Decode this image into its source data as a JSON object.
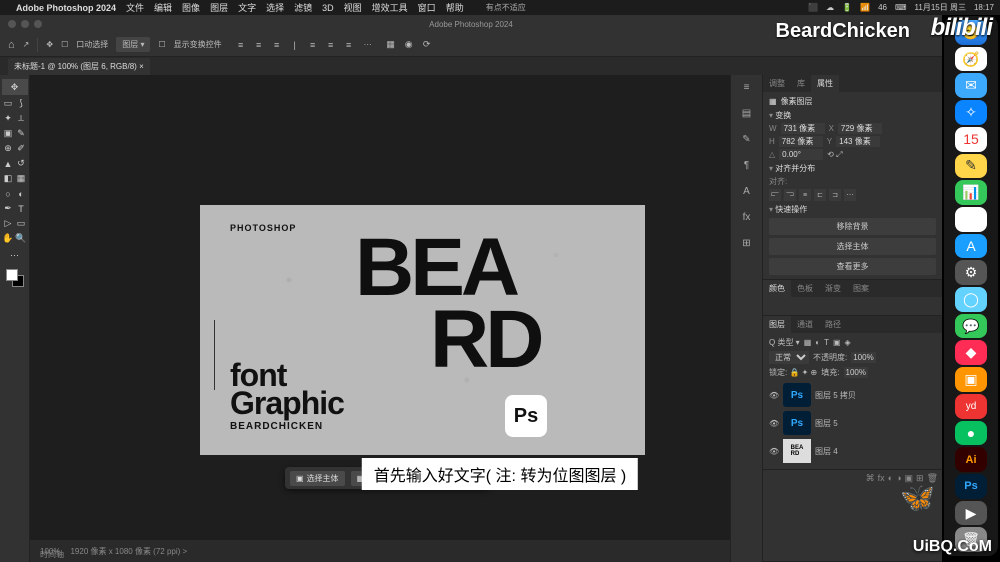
{
  "menubar": {
    "app": "Adobe Photoshop 2024",
    "items": [
      "文件",
      "编辑",
      "图像",
      "图层",
      "文字",
      "选择",
      "滤镜",
      "3D",
      "视图",
      "增效工具",
      "窗口",
      "帮助"
    ],
    "note": "有点不适应",
    "right": {
      "num1": "46",
      "label1": "周三",
      "date": "11月15日 周三",
      "time": "18:17"
    }
  },
  "window_title": "Adobe Photoshop 2024",
  "options": {
    "auto_select": "口动选择",
    "layer_dd": "图层 ▾",
    "show_transform": "显示变换控件",
    "three_dots": "···"
  },
  "tab": {
    "name": "未标题-1 @ 100% (图层 6, RGB/8)",
    "close": "×"
  },
  "status": {
    "zoom": "100%",
    "info": "1920 像素 x 1080 像素 (72 ppi)  >",
    "row2": "时间轴"
  },
  "canvas": {
    "photoshop": "PHOTOSHOP",
    "bea": "BEA",
    "rd": "RD",
    "font": "font",
    "graphic": "Graphic",
    "bc": "BEARDCHICKEN",
    "ps": "Ps"
  },
  "context": {
    "select_subject": "选择主体",
    "remove_bg": "移除背景"
  },
  "properties": {
    "tabs": [
      "调整",
      "库",
      "属性"
    ],
    "header": "像素图层",
    "transform": "变换",
    "w": "731 像素",
    "x_lbl": "X",
    "x": "729 像素",
    "h": "782 像素",
    "y_lbl": "Y",
    "y": "143 像素",
    "angle_lbl": "△",
    "angle": "0.00°",
    "flip": "⟲ ⤢",
    "align_section": "对齐并分布",
    "align_label": "对齐:",
    "quick_section": "快速操作",
    "btn1": "移除背景",
    "btn2": "选择主体",
    "btn3": "查看更多"
  },
  "channels": {
    "tabs": [
      "颜色",
      "色板",
      "渐变",
      "图案"
    ],
    "items": []
  },
  "layers": {
    "tabs": [
      "图层",
      "通道",
      "路径"
    ],
    "kind": "Q 类型 ▾",
    "mode": "正常",
    "opacity_lbl": "不透明度:",
    "opacity": "100%",
    "lock": "锁定: 🔒 ✦ ⊕",
    "fill_lbl": "填充:",
    "fill": "100%",
    "rows": [
      {
        "name": "图层 5 拷贝",
        "thumb": "ps"
      },
      {
        "name": "图层 5",
        "thumb": "ps"
      },
      {
        "name": "图层 4",
        "thumb": "beard"
      }
    ]
  },
  "subtitle": "首先输入好文字( 注: 转为位图图层 )",
  "watermarks": {
    "bc": "BeardChicken",
    "bili": "bilibili",
    "uibq": "UiBQ.CoM"
  }
}
